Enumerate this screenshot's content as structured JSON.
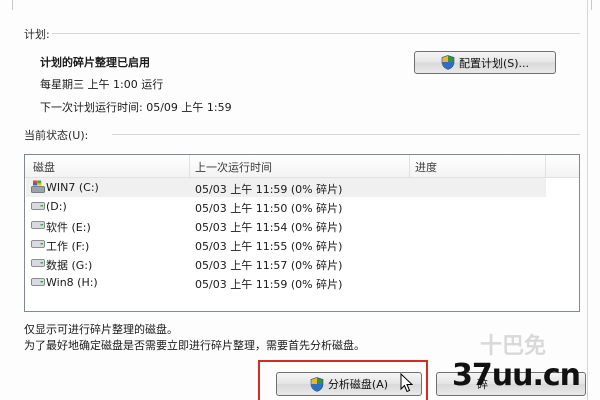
{
  "schedule": {
    "section_label": "计划:",
    "status": "计划的碎片整理已启用",
    "frequency": "每星期三 上午 1:00 运行",
    "next_run": "下一次计划运行时间: 05/09 上午 1:59",
    "configure_button": "配置计划(S)..."
  },
  "current_status": {
    "section_label": "当前状态(U):",
    "columns": [
      "磁盘",
      "上一次运行时间",
      "进度"
    ],
    "disks": [
      {
        "name": "WIN7 (C:)",
        "last_run": "05/03 上午 11:59 (0% 碎片)",
        "icon": "system-drive-icon",
        "selected": true
      },
      {
        "name": "(D:)",
        "last_run": "05/03 上午 11:50 (0% 碎片)",
        "icon": "drive-icon",
        "selected": false
      },
      {
        "name": "软件 (E:)",
        "last_run": "05/03 上午 11:54 (0% 碎片)",
        "icon": "drive-icon",
        "selected": false
      },
      {
        "name": "工作 (F:)",
        "last_run": "05/03 上午 11:55 (0% 碎片)",
        "icon": "drive-icon",
        "selected": false
      },
      {
        "name": "数据 (G:)",
        "last_run": "05/03 上午 11:57 (0% 碎片)",
        "icon": "drive-icon",
        "selected": false
      },
      {
        "name": "Win8 (H:)",
        "last_run": "05/03 上午 11:59 (0% 碎片)",
        "icon": "drive-icon",
        "selected": false
      }
    ]
  },
  "notes": {
    "line1": "仅显示可进行碎片整理的磁盘。",
    "line2": "为了最好地确定磁盘是否需要立即进行碎片整理，需要首先分析磁盘。"
  },
  "actions": {
    "analyze_button": "分析磁盘(A)",
    "defrag_button_partial": "碎"
  },
  "watermark": {
    "site": "37uu.cn",
    "faint": "十巴免"
  },
  "colors": {
    "highlight_border": "#d42a2a",
    "list_border": "#828790",
    "selected_row": "#f0f0f0"
  }
}
